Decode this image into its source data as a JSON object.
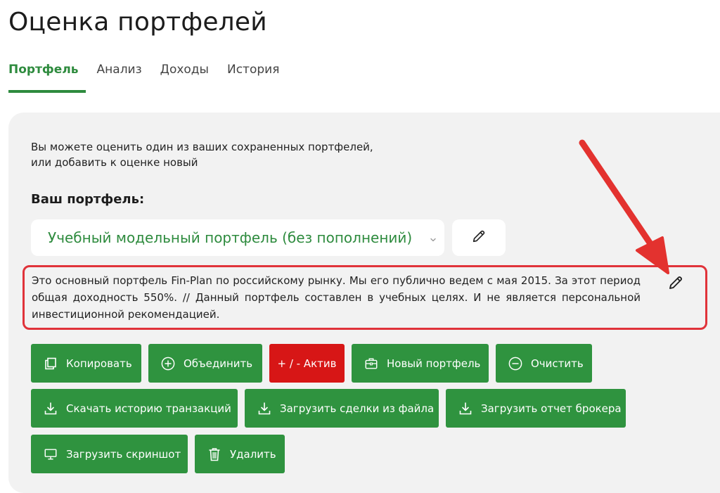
{
  "page": {
    "title": "Оценка портфелей"
  },
  "tabs": [
    {
      "label": "Портфель",
      "active": true
    },
    {
      "label": "Анализ",
      "active": false
    },
    {
      "label": "Доходы",
      "active": false
    },
    {
      "label": "История",
      "active": false
    }
  ],
  "intro": {
    "line1": "Вы можете оценить один из ваших сохраненных портфелей,",
    "line2": "или добавить к оценке новый"
  },
  "portfolio": {
    "label": "Ваш портфель:",
    "selected": "Учебный модельный портфель (без пополнений)",
    "description": "Это основный портфель Fin-Plan по российскому рынку. Мы его публично ведем с мая 2015. За этот период общая доходность 550%. // Данный портфель составлен в учебных целях. И не является персональной инвестиционной рекомендацией."
  },
  "buttons": {
    "copy": "Копировать",
    "merge": "Объединить",
    "asset": "+ / - Актив",
    "new_portfolio": "Новый портфель",
    "clear": "Очистить",
    "download_history": "Скачать историю транзакций",
    "upload_deals": "Загрузить сделки из файла",
    "upload_broker": "Загрузить отчет брокера",
    "upload_screenshot": "Загрузить скриншот",
    "delete": "Удалить"
  },
  "colors": {
    "accent_green": "#2f933f",
    "text_green": "#2e8b3e",
    "red_button": "#d71616",
    "highlight_red": "#e0333a",
    "card_bg": "#f2f2f2"
  },
  "icons": {
    "select": "chevron-down-icon",
    "edit": "pencil-icon",
    "copy": "copy-icon",
    "merge": "plus-circle-icon",
    "new_portfolio": "briefcase-icon",
    "clear": "minus-circle-icon",
    "download": "download-icon",
    "monitor": "monitor-icon",
    "trash": "trash-icon"
  }
}
